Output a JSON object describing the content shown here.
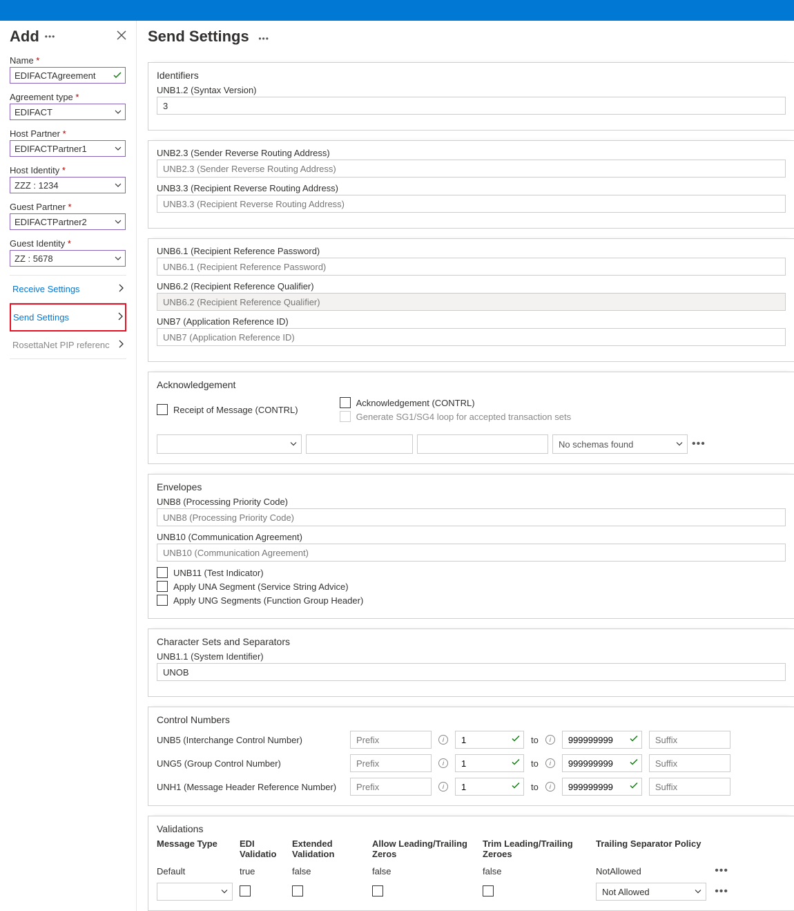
{
  "left": {
    "title": "Add",
    "fields": {
      "name": {
        "label": "Name",
        "value": "EDIFACTAgreement"
      },
      "agreementType": {
        "label": "Agreement type",
        "value": "EDIFACT"
      },
      "hostPartner": {
        "label": "Host Partner",
        "value": "EDIFACTPartner1"
      },
      "hostIdentity": {
        "label": "Host Identity",
        "value": "ZZZ : 1234"
      },
      "guestPartner": {
        "label": "Guest Partner",
        "value": "EDIFACTPartner2"
      },
      "guestIdentity": {
        "label": "Guest Identity",
        "value": "ZZ : 5678"
      }
    },
    "nav": {
      "receive": "Receive Settings",
      "send": "Send Settings",
      "rosetta": "RosettaNet PIP referenc"
    }
  },
  "right": {
    "title": "Send Settings"
  },
  "identifiers": {
    "section": "Identifiers",
    "unb12": {
      "label": "UNB1.2 (Syntax Version)",
      "value": "3"
    },
    "unb23": {
      "label": "UNB2.3 (Sender Reverse Routing Address)",
      "placeholder": "UNB2.3 (Sender Reverse Routing Address)"
    },
    "unb33": {
      "label": "UNB3.3 (Recipient Reverse Routing Address)",
      "placeholder": "UNB3.3 (Recipient Reverse Routing Address)"
    },
    "unb61": {
      "label": "UNB6.1 (Recipient Reference Password)",
      "placeholder": "UNB6.1 (Recipient Reference Password)"
    },
    "unb62": {
      "label": "UNB6.2 (Recipient Reference Qualifier)",
      "placeholder": "UNB6.2 (Recipient Reference Qualifier)"
    },
    "unb7": {
      "label": "UNB7 (Application Reference ID)",
      "placeholder": "UNB7 (Application Reference ID)"
    }
  },
  "ack": {
    "section": "Acknowledgement",
    "receipt": "Receipt of Message (CONTRL)",
    "ackContrl": "Acknowledgement (CONTRL)",
    "genLoop": "Generate SG1/SG4 loop for accepted transaction sets",
    "noSchemas": "No schemas found"
  },
  "envelopes": {
    "section": "Envelopes",
    "unb8": {
      "label": "UNB8 (Processing Priority Code)",
      "placeholder": "UNB8 (Processing Priority Code)"
    },
    "unb10": {
      "label": "UNB10 (Communication Agreement)",
      "placeholder": "UNB10 (Communication Agreement)"
    },
    "unb11": "UNB11 (Test Indicator)",
    "una": "Apply UNA Segment (Service String Advice)",
    "ung": "Apply UNG Segments (Function Group Header)"
  },
  "charsets": {
    "section": "Character Sets and Separators",
    "unb11": {
      "label": "UNB1.1 (System Identifier)",
      "value": "UNOB"
    }
  },
  "control": {
    "section": "Control Numbers",
    "prefix": "Prefix",
    "suffix": "Suffix",
    "to": "to",
    "rows": [
      {
        "label": "UNB5 (Interchange Control Number)",
        "from": "1",
        "to": "999999999"
      },
      {
        "label": "UNG5 (Group Control Number)",
        "from": "1",
        "to": "999999999"
      },
      {
        "label": "UNH1 (Message Header Reference Number)",
        "from": "1",
        "to": "999999999"
      }
    ]
  },
  "validations": {
    "section": "Validations",
    "headers": {
      "msg": "Message Type",
      "edi": "EDI Validatio",
      "ext": "Extended Validation",
      "allow": "Allow Leading/Trailing Zeros",
      "trim": "Trim Leading/Trailing Zeroes",
      "pol": "Trailing Separator Policy"
    },
    "defaultRow": {
      "msg": "Default",
      "edi": "true",
      "ext": "false",
      "allow": "false",
      "trim": "false",
      "pol": "NotAllowed"
    },
    "editRow": {
      "pol": "Not Allowed"
    }
  }
}
